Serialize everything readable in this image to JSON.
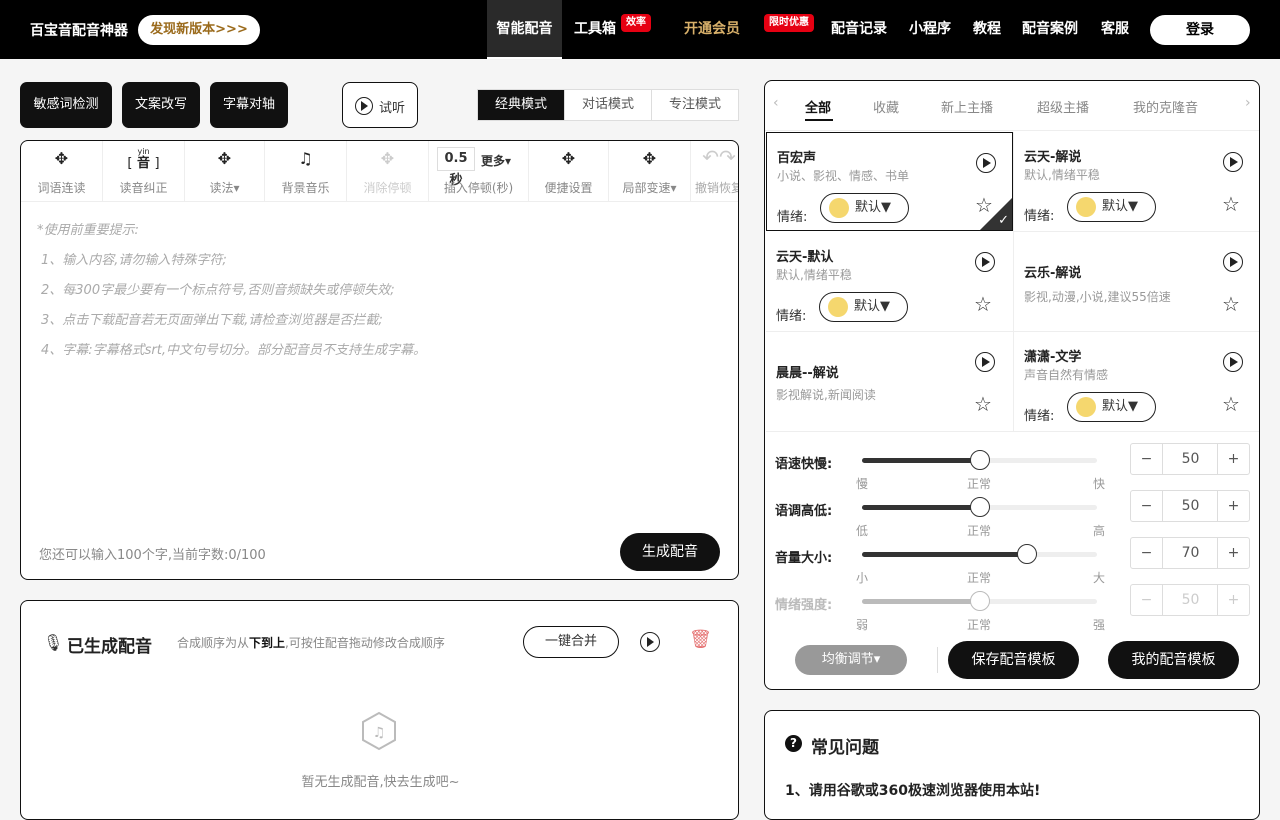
{
  "header": {
    "brand": "百宝音配音神器",
    "new_version": "发现新版本>>>",
    "nav": [
      {
        "label": "智能配音",
        "active": true
      },
      {
        "label": "工具箱",
        "badge": "效率"
      },
      {
        "label": "开通会员",
        "badge": "限时优惠"
      },
      {
        "label": "配音记录"
      },
      {
        "label": "小程序"
      },
      {
        "label": "教程"
      },
      {
        "label": "配音案例"
      },
      {
        "label": "客服"
      }
    ],
    "login": "登录"
  },
  "toolbar_top": {
    "buttons": [
      "敏感词检测",
      "文案改写",
      "字幕对轴"
    ],
    "listen": "试听",
    "modes": [
      "经典模式",
      "对话模式",
      "专注模式"
    ]
  },
  "editor": {
    "tools": [
      {
        "icon": "link-icon",
        "label": "词语连读"
      },
      {
        "icon": "pinyin-icon",
        "label": "读音纠正",
        "glyph_top": "yin",
        "glyph": "音"
      },
      {
        "icon": "reading-icon",
        "label": "读法▾"
      },
      {
        "icon": "music-icon",
        "label": "背景音乐"
      },
      {
        "icon": "clear-pause-icon",
        "label": "消除停顿"
      },
      {
        "icon": "pause-icon",
        "label": "插入停顿(秒)",
        "value": "0.5秒",
        "more": "更多▾"
      },
      {
        "icon": "settings-icon",
        "label": "便捷设置"
      },
      {
        "icon": "speed-icon",
        "label": "局部变速▾"
      },
      {
        "icon": "undo-redo-icon",
        "label": "撤销恢复"
      }
    ],
    "tips_title": "*使用前重要提示:",
    "tips": [
      "1、输入内容,请勿输入特殊字符;",
      "2、每300字最少要有一个标点符号,否则音频缺失或停顿失效;",
      "3、点击下载配音若无页面弹出下载,请检查浏览器是否拦截;",
      "4、字幕:字幕格式srt,中文句号切分。部分配音员不支持生成字幕。"
    ],
    "count_text": "您还可以输入100个字,当前字数:0/100",
    "generate": "生成配音"
  },
  "generated": {
    "title": "已生成配音",
    "hint_prefix": "合成顺序为从",
    "hint_bold": "下到上",
    "hint_suffix": ",可按住配音拖动修改合成顺序",
    "merge": "一键合并",
    "empty": "暂无生成配音,快去生成吧~"
  },
  "voices": {
    "tabs": [
      "全部",
      "收藏",
      "新上主播",
      "超级主播",
      "我的克隆音"
    ],
    "cards": [
      {
        "name": "百宏声",
        "desc": "小说、影视、情感、书单",
        "emotion": "默认▼",
        "selected": true
      },
      {
        "name": "云天-解说",
        "desc": "默认,情绪平稳",
        "emotion": "默认▼"
      },
      {
        "name": "云天-默认",
        "desc": "默认,情绪平稳",
        "emotion": "默认▼"
      },
      {
        "name": "云乐-解说",
        "desc": "影视,动漫,小说,建议55倍速"
      },
      {
        "name": "晨晨--解说",
        "desc": "影视解说,新闻阅读"
      },
      {
        "name": "潇潇-文学",
        "desc": "声音自然有情感",
        "emotion": "默认▼"
      }
    ],
    "emotion_label": "情绪:",
    "sliders": [
      {
        "label": "语速快慢:",
        "value": 50,
        "min": "慢",
        "mid": "正常",
        "max": "快"
      },
      {
        "label": "语调高低:",
        "value": 50,
        "min": "低",
        "mid": "正常",
        "max": "高"
      },
      {
        "label": "音量大小:",
        "value": 70,
        "min": "小",
        "mid": "正常",
        "max": "大"
      },
      {
        "label": "情绪强度:",
        "value": 50,
        "min": "弱",
        "mid": "正常",
        "max": "强",
        "disabled": true
      }
    ],
    "balance": "均衡调节▾",
    "save_template": "保存配音模板",
    "my_template": "我的配音模板"
  },
  "faq": {
    "title": "常见问题",
    "q1": "1、请用谷歌或360极速浏览器使用本站!"
  }
}
